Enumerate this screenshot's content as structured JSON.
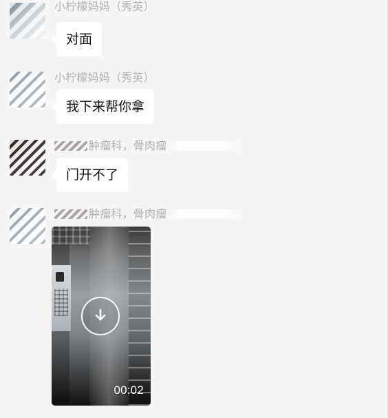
{
  "messages": [
    {
      "sender_name": "小柠檬妈妈（秀英）",
      "text": "对面"
    },
    {
      "sender_name": "小柠檬妈妈（秀英）",
      "text": "我下来帮你拿"
    },
    {
      "sender_name": "肿瘤科，骨肉瘤",
      "text": "门开不了"
    },
    {
      "sender_name": "肿瘤科，骨肉瘤",
      "video": {
        "duration": "00:02",
        "overlay_icon": "download-arrow-icon"
      }
    }
  ],
  "colors": {
    "chat_background": "#f5f5f5",
    "bubble_background": "#ffffff",
    "sender_name_text": "#b0b0b0",
    "message_text": "#111111"
  }
}
